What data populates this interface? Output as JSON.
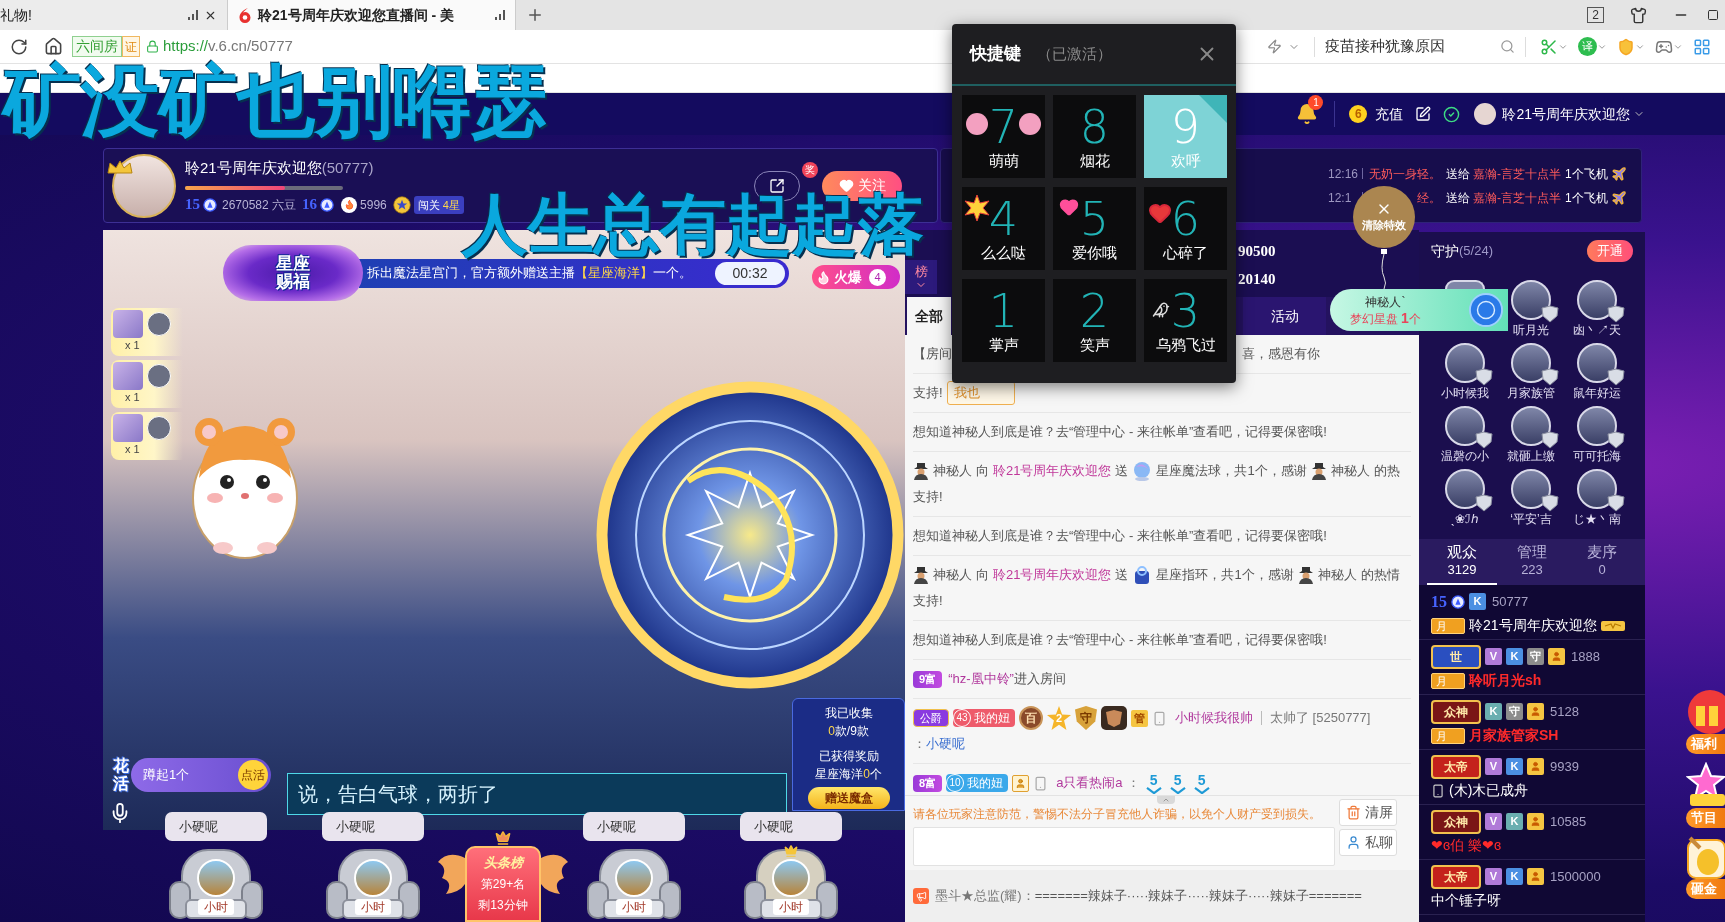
{
  "browser": {
    "tabs": [
      {
        "title": "礼物!",
        "selected": false
      },
      {
        "title": "聆21号周年庆欢迎您直播间 - 美",
        "selected": true
      }
    ],
    "window_count": "2",
    "site_badge": "六间房",
    "verified_badge": "证",
    "url_scheme": "https://",
    "url_rest": "v.6.cn/50777",
    "search": {
      "value": "疫苗接种犹豫原因"
    },
    "translate": "译"
  },
  "desktop_lyrics": [
    {
      "text": "矿没矿也别嘚瑟"
    },
    {
      "text": "人生总有起起落"
    }
  ],
  "site_nav": {
    "bell_count": "1",
    "coin": "6",
    "recharge": "充值",
    "user_name": "聆21号周年庆欢迎您"
  },
  "anchor": {
    "name": "聆21号周年庆欢迎您",
    "room_id": "(50777)",
    "progress": {
      "level": 0.63
    },
    "wealth_level": "15",
    "beans": "2670582 六豆",
    "next_level": "16",
    "heat": "5996",
    "challenge": "闯关",
    "challenge_stars": "4星",
    "share_badge": "奖",
    "follow": "关注"
  },
  "gift_notices": [
    {
      "time": "12:16",
      "sender": "无奶一身轻。",
      "verb": "送给",
      "receiver": "嘉瀚-言芝十点半",
      "gift": "1个飞机"
    },
    {
      "time": "12:1",
      "sender": "经。",
      "verb": "送给",
      "receiver": "嘉瀚-言芝十点半",
      "gift": "1个飞机"
    }
  ],
  "video": {
    "banner": {
      "logo": "星座赐福",
      "text_before": "拆出魔法星宫门，官方额外赠送主播",
      "highlight": "【星座海洋】",
      "text_after": "一个。",
      "timer": "00:32"
    },
    "hot": {
      "label": "火爆",
      "count": "4"
    },
    "gift_stack": [
      {
        "count": "x 1"
      },
      {
        "count": "x 1"
      },
      {
        "count": "x 1"
      }
    ],
    "flower": {
      "logo": "花活",
      "label": "蹲起1个",
      "button": "点活"
    },
    "announcement": "说，告白气球，两折了",
    "collection": {
      "collected_label": "我已收集",
      "collected_count": "0",
      "collected_unit": "款/9款",
      "reward_label": "已获得奖励",
      "reward_name": "星座海洋",
      "reward_count": "0",
      "reward_unit": "个",
      "button": "赠送魔盒"
    }
  },
  "seats": [
    {
      "name": "小硬呢",
      "label": "小时",
      "crowned": false
    },
    {
      "name": "小硬呢",
      "label": "小时",
      "crowned": false
    },
    {
      "name": "小硬呢",
      "label": "小时",
      "crowned": false
    },
    {
      "name": "小硬呢",
      "label": "小时",
      "crowned": true
    }
  ],
  "headline": {
    "title": "头条榜",
    "rank": "第29+名",
    "remaining": "剩13分钟"
  },
  "rank": {
    "tab": "榜",
    "scores": [
      "90500",
      "20140"
    ]
  },
  "chat_tabs": [
    {
      "label": "全部",
      "selected": true
    },
    {
      "label": "活动",
      "selected": false
    }
  ],
  "chat": [
    {
      "kind": "notice",
      "text_start": "【房间",
      "text_end": "喜，感恩有你"
    },
    {
      "kind": "support",
      "text": "支持!",
      "button": "我也"
    },
    {
      "kind": "system",
      "text": "想知道神秘人到底是谁？去“管理中心 - 来往帐单”查看吧，记得要保密哦!"
    },
    {
      "kind": "gift",
      "sender": "神秘人",
      "verb": "向",
      "receiver": "聆21号周年庆欢迎您",
      "send": "送",
      "gift_picture": {
        "kind": "orb"
      },
      "gift": "星座魔法球，共1个，感谢",
      "thanker": "神秘人",
      "tail": "的热",
      "continuation": "支持!"
    },
    {
      "kind": "system",
      "text": "想知道神秘人到底是谁？去“管理中心 - 来往帐单”查看吧，记得要保密哦!"
    },
    {
      "kind": "gift",
      "sender": "神秘人",
      "verb": "向",
      "receiver": "聆21号周年庆欢迎您",
      "send": "送",
      "gift_picture": {
        "kind": "ring"
      },
      "gift": "星座指环，共1个，感谢",
      "thanker": "神秘人",
      "tail": "的热情",
      "continuation": "支持!"
    },
    {
      "kind": "system",
      "text": "想知道神秘人到底是谁？去“管理中心 - 来往帐单”查看吧，记得要保密哦!"
    },
    {
      "kind": "enter",
      "rich": "9富",
      "name": "“hz-凰中铃”",
      "text": "进入房间"
    },
    {
      "kind": "message",
      "noble": "公爵",
      "fan": {
        "level": "43",
        "label": "我的妞",
        "color": "#ee5b6b"
      },
      "medals": [
        {
          "kind": "medal",
          "text": "百"
        },
        {
          "kind": "star",
          "text": "2"
        },
        {
          "kind": "shield",
          "text": "守"
        },
        {
          "kind": "armor"
        },
        {
          "kind": "admin",
          "text": "管"
        },
        {
          "kind": "phone"
        }
      ],
      "name": "小时候我很帅",
      "title": "太帅了 [5250777]",
      "prefix": "：",
      "reply": "小硬呢"
    },
    {
      "kind": "message",
      "rich": "8富",
      "fan": {
        "level": "10",
        "label": "我的妞",
        "color": "#3aa8ea"
      },
      "medals": [
        {
          "kind": "member"
        },
        {
          "kind": "phone"
        }
      ],
      "name": "a只看热闹a",
      "prefix": "：",
      "stickers": [
        "5",
        "5",
        "5"
      ]
    }
  ],
  "safety_notice": "请各位玩家注意防范，警惕不法分子冒充他人诈骗，以免个人财产受到损失。",
  "chat_actions": [
    {
      "label": "清屏",
      "kind": "clear"
    },
    {
      "label": "私聊",
      "kind": "private"
    }
  ],
  "broadcast": {
    "sender": "墨斗★总监(耀)：",
    "text": "=======辣妹子·····辣妹子·····辣妹子·····辣妹子======="
  },
  "guards": {
    "title": "守护",
    "count": "(5/24)",
    "button": "开通",
    "members": [
      {
        "kind": "covered"
      },
      {
        "kind": "guard",
        "name": "听月光"
      },
      {
        "kind": "guard",
        "name": "凼丶↗天"
      },
      {
        "kind": "guard",
        "name": "小时候我"
      },
      {
        "kind": "guard",
        "name": "月家族管"
      },
      {
        "kind": "guard",
        "name": "鼠年好运"
      },
      {
        "kind": "guard",
        "name": "温磬の小"
      },
      {
        "kind": "guard",
        "name": "就砸上缴"
      },
      {
        "kind": "guard",
        "name": "可可托海"
      },
      {
        "kind": "guard",
        "name": "ˎ❀ℐℎ"
      },
      {
        "kind": "guard",
        "name": "‘平安’吉"
      },
      {
        "kind": "guard",
        "name": "じ★丶南"
      }
    ]
  },
  "audience_tabs": [
    {
      "label": "观众",
      "count": "3129",
      "selected": true
    },
    {
      "label": "管理",
      "count": "223",
      "selected": false
    },
    {
      "label": "麦序",
      "count": "0",
      "selected": false
    }
  ],
  "audience": [
    {
      "kind": "normal",
      "badge": {
        "kind": "level",
        "text": "15"
      },
      "tags": [
        {
          "kind": "letter",
          "text": "K",
          "color": "#4b8fe2"
        }
      ],
      "id": "50777",
      "month": "月",
      "name": "聆21号周年庆欢迎您",
      "suffix_icons": [
        {
          "kind": "wing_badge"
        }
      ]
    },
    {
      "kind": "highlight",
      "badge": {
        "kind": "title",
        "text": "世",
        "color": "#2a4fc0"
      },
      "tags": [
        {
          "kind": "letter",
          "text": "V",
          "color": "#b07ad8"
        },
        {
          "kind": "letter",
          "text": "K",
          "color": "#4b8fe2"
        },
        {
          "kind": "letter",
          "text": "守",
          "color": "#8c8c8c"
        },
        {
          "kind": "member",
          "color": "#f5c542"
        }
      ],
      "id": "1888",
      "month": "月",
      "name": "聆听月光sh"
    },
    {
      "kind": "highlight",
      "badge": {
        "kind": "title",
        "text": "众神",
        "color": "#7a1616"
      },
      "tags": [
        {
          "kind": "letter",
          "text": "K",
          "color": "#6aaeb0"
        },
        {
          "kind": "letter",
          "text": "守",
          "color": "#8c8c8c"
        },
        {
          "kind": "member",
          "color": "#f5c542"
        }
      ],
      "id": "5128",
      "month": "月",
      "name": "月家族管家SH"
    },
    {
      "kind": "normal",
      "badge": {
        "kind": "title",
        "text": "太帝",
        "color": "#c4221c"
      },
      "tags": [
        {
          "kind": "letter",
          "text": "V",
          "color": "#b07ad8"
        },
        {
          "kind": "letter",
          "text": "K",
          "color": "#4b8fe2"
        },
        {
          "kind": "member",
          "color": "#f5c542"
        }
      ],
      "id": "9939",
      "prefix_icons": [
        {
          "kind": "phone"
        }
      ],
      "name": "(木)木已成舟"
    },
    {
      "kind": "red",
      "badge": {
        "kind": "title",
        "text": "众神",
        "color": "#7a1616"
      },
      "tags": [
        {
          "kind": "letter",
          "text": "V",
          "color": "#b07ad8"
        },
        {
          "kind": "letter",
          "text": "K",
          "color": "#6aaeb0"
        },
        {
          "kind": "member",
          "color": "#f5c542"
        }
      ],
      "id": "10585",
      "name": "❤ɞ伯 樂❤ɞ"
    },
    {
      "kind": "normal",
      "badge": {
        "kind": "title",
        "text": "太帝",
        "color": "#c4221c"
      },
      "tags": [
        {
          "kind": "letter",
          "text": "V",
          "color": "#b07ad8"
        },
        {
          "kind": "letter",
          "text": "K",
          "color": "#4b8fe2"
        },
        {
          "kind": "member",
          "color": "#f5c542"
        }
      ],
      "id": "1500000",
      "name": "中个锤子呀"
    }
  ],
  "promos": [
    {
      "label": "福利",
      "kind": "gift"
    },
    {
      "label": "节目",
      "kind": "show"
    },
    {
      "label": "砸金",
      "kind": "egg"
    }
  ],
  "quick_keys": {
    "title": "快捷键",
    "status": "（已激活）",
    "keys": [
      {
        "key": "7",
        "label": "萌萌",
        "kind": "cute",
        "selected": false
      },
      {
        "key": "8",
        "label": "烟花",
        "kind": "fireworks",
        "selected": false
      },
      {
        "key": "9",
        "label": "欢呼",
        "kind": "cheer",
        "selected": true
      },
      {
        "key": "4",
        "label": "么么哒",
        "kind": "kiss",
        "selected": false
      },
      {
        "key": "5",
        "label": "爱你哦",
        "kind": "love",
        "selected": false
      },
      {
        "key": "6",
        "label": "心碎了",
        "kind": "heartbreak",
        "selected": false
      },
      {
        "key": "1",
        "label": "掌声",
        "kind": "applause",
        "selected": false
      },
      {
        "key": "2",
        "label": "笑声",
        "kind": "laugh",
        "selected": false
      },
      {
        "key": "3",
        "label": "乌鸦飞过",
        "kind": "crow",
        "selected": false
      }
    ]
  },
  "clear_effects": {
    "label": "清除特效"
  },
  "gift_balloon": {
    "sender": "神秘人`",
    "gift": "梦幻星盘",
    "count": "1",
    "unit": "个"
  }
}
